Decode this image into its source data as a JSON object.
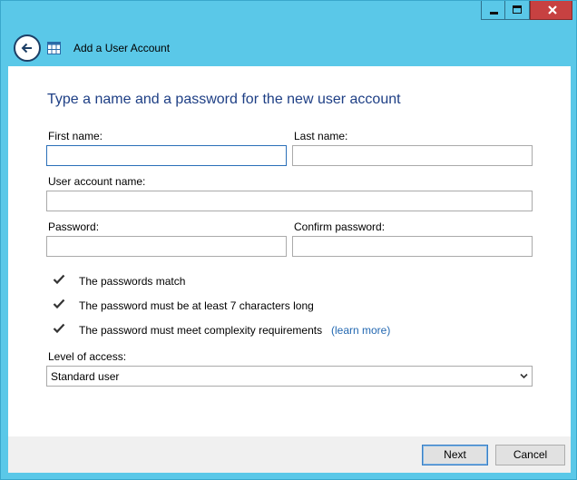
{
  "window": {
    "caption_buttons": [
      "minimize",
      "maximize",
      "close"
    ],
    "accent_color": "#5ac8e8",
    "close_color": "#c74141"
  },
  "nav": {
    "title": "Add a User Account",
    "back_icon": "back-arrow-icon",
    "control_panel_icon": "control-panel-icon"
  },
  "form": {
    "heading": "Type a name and a password for the new user account",
    "first_name_label": "First name:",
    "first_name_value": "",
    "last_name_label": "Last name:",
    "last_name_value": "",
    "account_name_label": "User account name:",
    "account_name_value": "",
    "password_label": "Password:",
    "password_value": "",
    "confirm_password_label": "Confirm password:",
    "confirm_password_value": ""
  },
  "requirements": [
    {
      "text": "The passwords match",
      "icon": "checkmark-icon"
    },
    {
      "text": "The password must be at least 7 characters long",
      "icon": "checkmark-icon"
    },
    {
      "text": "The password must meet complexity requirements",
      "icon": "checkmark-icon"
    }
  ],
  "learn_more": "(learn more)",
  "access": {
    "label": "Level of access:",
    "selected": "Standard user"
  },
  "buttons": {
    "next": "Next",
    "cancel": "Cancel"
  }
}
